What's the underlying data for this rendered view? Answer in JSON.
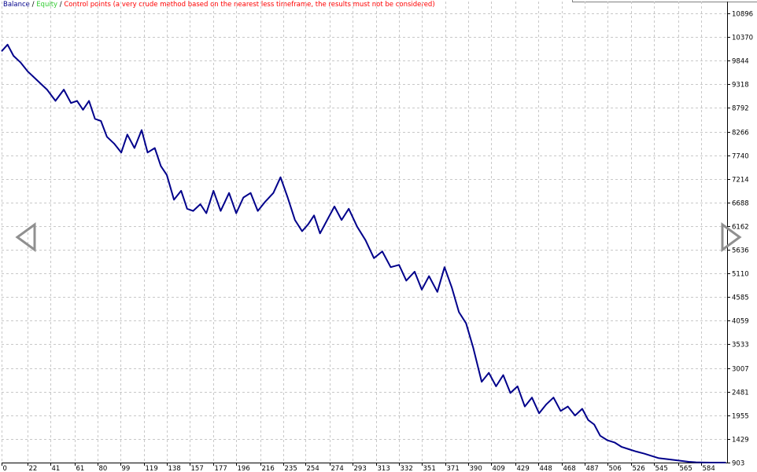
{
  "legend": {
    "balance": "Balance",
    "sep1": " / ",
    "equity": "Equity",
    "sep2": " / ",
    "control": "Control points (a very crude method based on the nearest less timeframe, the results must not be considered)"
  },
  "colors": {
    "balance": "#00008b",
    "equity": "#32cd32",
    "control": "#ff0000",
    "grid": "#c8c8c8",
    "nav_arrow": "#909090"
  },
  "icons": {
    "prev": "triangle-left-icon",
    "next": "triangle-right-icon"
  },
  "chart_data": {
    "type": "line",
    "grid": true,
    "ylim": [
      903,
      11158
    ],
    "xlim": [
      0,
      606
    ],
    "y_ticks": [
      903,
      1429,
      1955,
      2481,
      3007,
      3533,
      4059,
      4585,
      5110,
      5636,
      6162,
      6688,
      7214,
      7740,
      8266,
      8792,
      9318,
      9844,
      10370,
      10896
    ],
    "x_ticks": [
      0,
      22,
      41,
      61,
      80,
      99,
      119,
      138,
      157,
      177,
      196,
      216,
      235,
      254,
      274,
      293,
      313,
      332,
      351,
      371,
      390,
      409,
      429,
      448,
      468,
      487,
      506,
      526,
      545,
      565,
      584
    ],
    "series": [
      {
        "name": "Balance",
        "x": [
          0,
          5,
          10,
          16,
          22,
          30,
          38,
          45,
          52,
          58,
          63,
          68,
          73,
          78,
          83,
          88,
          94,
          100,
          105,
          111,
          117,
          122,
          128,
          133,
          138,
          144,
          150,
          155,
          160,
          166,
          171,
          177,
          183,
          190,
          196,
          202,
          208,
          214,
          220,
          227,
          233,
          239,
          245,
          251,
          256,
          261,
          266,
          272,
          278,
          284,
          290,
          297,
          304,
          311,
          318,
          325,
          332,
          338,
          345,
          351,
          357,
          364,
          370,
          376,
          382,
          388,
          394,
          401,
          407,
          413,
          419,
          425,
          431,
          437,
          443,
          449,
          455,
          461,
          467,
          473,
          479,
          485,
          490,
          495,
          500,
          506,
          512,
          518,
          524,
          530,
          537,
          543,
          549,
          556,
          562,
          568,
          574,
          580,
          586,
          592,
          598,
          602,
          605
        ],
        "y": [
          10050,
          10200,
          9950,
          9800,
          9600,
          9400,
          9200,
          8950,
          9200,
          8900,
          8950,
          8750,
          8950,
          8550,
          8500,
          8150,
          8000,
          7800,
          8200,
          7900,
          8300,
          7800,
          7900,
          7500,
          7300,
          6750,
          6950,
          6550,
          6500,
          6650,
          6450,
          6950,
          6500,
          6900,
          6450,
          6800,
          6900,
          6500,
          6700,
          6900,
          7250,
          6800,
          6300,
          6050,
          6200,
          6400,
          6000,
          6300,
          6600,
          6300,
          6550,
          6150,
          5850,
          5450,
          5600,
          5250,
          5300,
          4950,
          5150,
          4750,
          5050,
          4700,
          5250,
          4800,
          4250,
          4000,
          3450,
          2700,
          2900,
          2600,
          2850,
          2450,
          2600,
          2150,
          2350,
          2000,
          2200,
          2350,
          2050,
          2150,
          1950,
          2100,
          1850,
          1750,
          1500,
          1400,
          1350,
          1250,
          1200,
          1150,
          1100,
          1050,
          1000,
          980,
          960,
          940,
          920,
          910,
          905,
          903,
          903,
          903,
          903
        ],
        "color": "#00008b"
      },
      {
        "name": "Equity",
        "note_points": [],
        "color": "#32cd32"
      }
    ]
  }
}
